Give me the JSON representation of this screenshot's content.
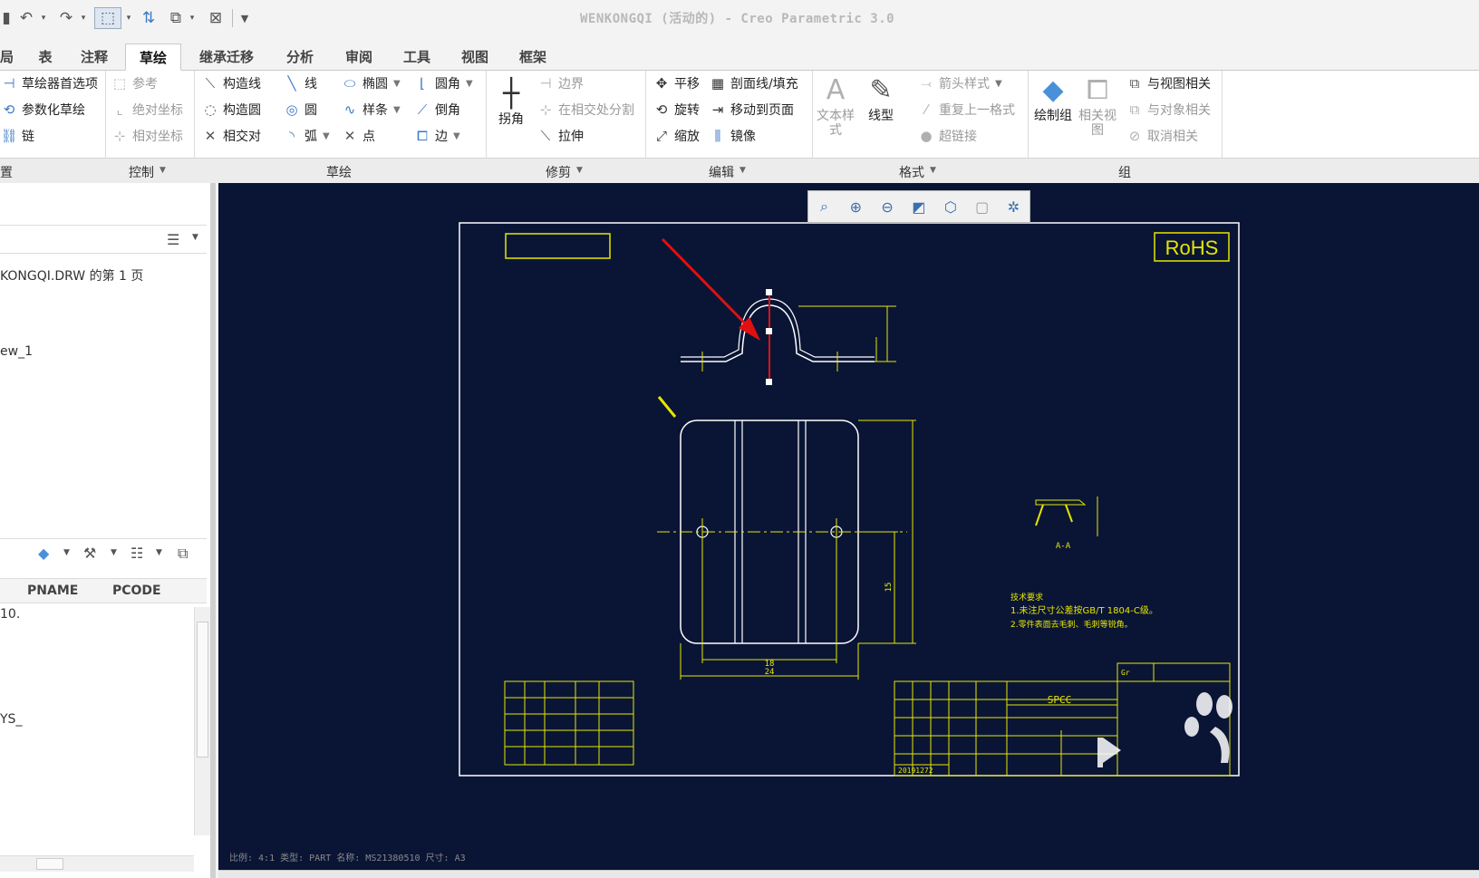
{
  "titlebar": {
    "title": "WENKONGQI (活动的) - Creo Parametric 3.0",
    "quick_access": [
      "save-icon",
      "undo-icon",
      "redo-icon",
      "select-box-icon",
      "regenerate-icon",
      "windows-icon",
      "close-window-icon",
      "customize-icon"
    ]
  },
  "tabs": [
    {
      "label": "局"
    },
    {
      "label": "表"
    },
    {
      "label": "注释"
    },
    {
      "label": "草绘"
    },
    {
      "label": "继承迁移"
    },
    {
      "label": "分析"
    },
    {
      "label": "审阅"
    },
    {
      "label": "工具"
    },
    {
      "label": "视图"
    },
    {
      "label": "框架"
    }
  ],
  "ribbon": {
    "settings": {
      "items": [
        "草绘器首选项",
        "参数化草绘",
        "链"
      ],
      "group": "置"
    },
    "control": {
      "items": [
        "参考",
        "绝对坐标",
        "相对坐标"
      ],
      "group": "控制"
    },
    "sketch": {
      "col1": [
        "构造线",
        "构造圆",
        "相交对"
      ],
      "col2": [
        "线",
        "圆",
        "弧"
      ],
      "col3": [
        "椭圆",
        "样条",
        "点"
      ],
      "col4": [
        "圆角",
        "倒角",
        "边"
      ],
      "group": "草绘"
    },
    "trim": {
      "big": "拐角",
      "items": [
        "边界",
        "在相交处分割",
        "拉伸"
      ],
      "group": "修剪"
    },
    "edit": {
      "col1": [
        "平移",
        "旋转",
        "缩放"
      ],
      "col2": [
        "剖面线/填充",
        "移动到页面",
        "镜像"
      ],
      "group": "编辑"
    },
    "format": {
      "big1": "文本样式",
      "big2": "线型",
      "items": [
        "箭头样式",
        "重复上一格式",
        "超链接"
      ],
      "group": "格式"
    },
    "grp": {
      "big1": "绘制组",
      "big2": "相关视图",
      "items": [
        "与视图相关",
        "与对象相关",
        "取消相关"
      ],
      "group": "组"
    }
  },
  "leftpanel": {
    "tree_item_1": "KONGQI.DRW 的第 1 页",
    "tree_item_2": "ew_1",
    "columns": [
      "PNAME",
      "PCODE"
    ],
    "row1": "10.",
    "row2": "YS_"
  },
  "drawing": {
    "rohs": "RoHS",
    "section_label": "A-A",
    "dim_18": "18",
    "dim_24": "24",
    "dim_15": "15",
    "notes_title": "技术要求",
    "note_1": "1.未注尺寸公差按GB/T 1804-C级。",
    "note_2": "2.零件表面去毛刺、毛刺等锐角。",
    "material": "SPCC",
    "date": "20191272",
    "gr": "Gr"
  },
  "statusbar": "比例: 4:1     类型: PART   名称: MS21380510   尺寸: A3",
  "colors": {
    "canvas_bg": "#0a1535",
    "drawing_line": "#e6e600",
    "geometry": "#ffffff",
    "arrow": "#e01010",
    "accent": "#3b78c4"
  }
}
